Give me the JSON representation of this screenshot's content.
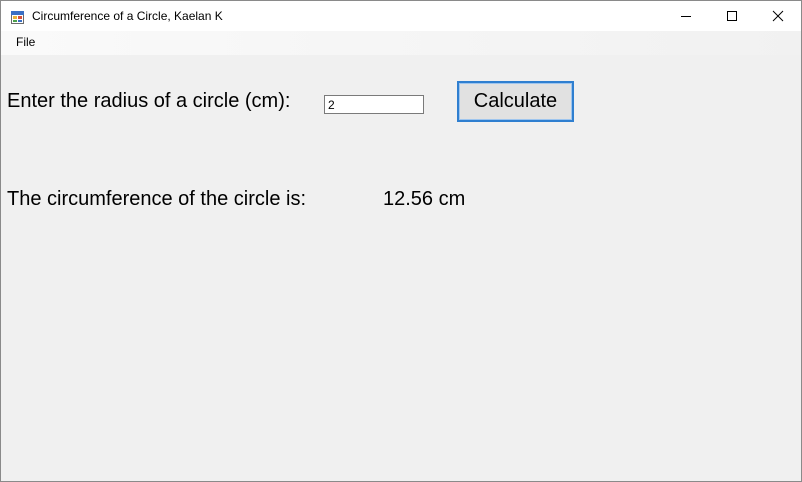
{
  "window": {
    "title": "Circumference of a Circle, Kaelan K",
    "icon": "windows-form-icon"
  },
  "menu": {
    "items": [
      {
        "label": "File"
      }
    ]
  },
  "form": {
    "radius_label": "Enter the radius of a circle (cm):",
    "radius_value": "2",
    "calculate_label": "Calculate",
    "result_label": "The circumference of the circle is:",
    "result_value": "12.56 cm"
  },
  "colors": {
    "background": "#f0f0f0",
    "button_border_focus": "#2f7fd0",
    "button_face": "#e1e1e1"
  }
}
